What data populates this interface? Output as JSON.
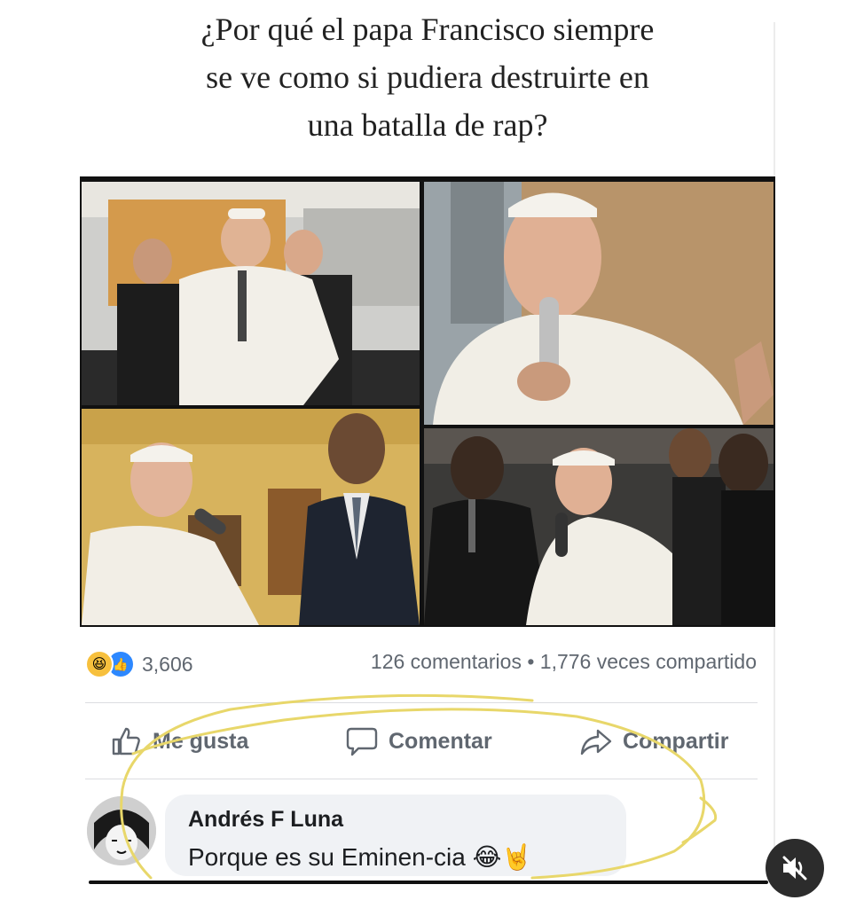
{
  "post": {
    "title_lines": [
      "¿Por qué el papa Francisco siempre",
      "se ve como si pudiera destruirte en",
      "una batalla de rap?"
    ],
    "reactions": {
      "icons": [
        "haha-emoji-icon",
        "like-icon"
      ],
      "count": "3,606"
    },
    "engagement": {
      "comments": "126 comentarios",
      "separator": "•",
      "shares": "1,776 veces compartido"
    },
    "actions": {
      "like_label": "Me gusta",
      "comment_label": "Comentar",
      "share_label": "Compartir"
    },
    "comment": {
      "author": "Andrés F Luna",
      "text": "Porque es su Eminen-cia 😂🤘"
    }
  },
  "colors": {
    "annotation": "#e8d76a",
    "like_blue": "#2d88ff",
    "haha_yellow": "#f7c03d",
    "meta_gray": "#606770"
  }
}
